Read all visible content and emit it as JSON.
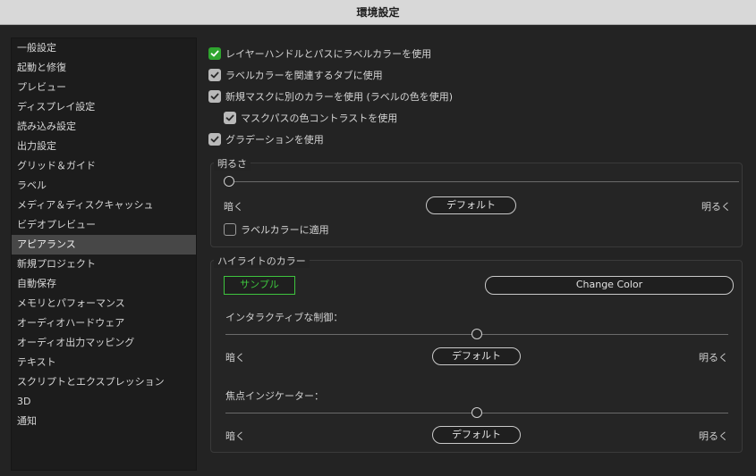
{
  "window": {
    "title": "環境設定"
  },
  "sidebar": {
    "items": [
      {
        "label": "一般設定"
      },
      {
        "label": "起動と修復"
      },
      {
        "label": "プレビュー"
      },
      {
        "label": "ディスプレイ設定"
      },
      {
        "label": "読み込み設定"
      },
      {
        "label": "出力設定"
      },
      {
        "label": "グリッド＆ガイド"
      },
      {
        "label": "ラベル"
      },
      {
        "label": "メディア＆ディスクキャッシュ"
      },
      {
        "label": "ビデオプレビュー"
      },
      {
        "label": "アピアランス",
        "selected": true
      },
      {
        "label": "新規プロジェクト"
      },
      {
        "label": "自動保存"
      },
      {
        "label": "メモリとパフォーマンス"
      },
      {
        "label": "オーディオハードウェア"
      },
      {
        "label": "オーディオ出力マッピング"
      },
      {
        "label": "テキスト"
      },
      {
        "label": "スクリプトとエクスプレッション"
      },
      {
        "label": "3D"
      },
      {
        "label": "通知"
      }
    ]
  },
  "options": {
    "layer_handles": {
      "label": "レイヤーハンドルとパスにラベルカラーを使用",
      "checked": true
    },
    "related_tabs": {
      "label": "ラベルカラーを関連するタブに使用",
      "checked": true
    },
    "new_mask": {
      "label": "新規マスクに別のカラーを使用 (ラベルの色を使用)",
      "checked": true
    },
    "mask_path_contrast": {
      "label": "マスクパスの色コントラストを使用",
      "checked": true
    },
    "gradients": {
      "label": "グラデーションを使用",
      "checked": true
    }
  },
  "brightness": {
    "title": "明るさ",
    "value": 0.0,
    "dark_label": "暗く",
    "light_label": "明るく",
    "default_label": "デフォルト",
    "apply_label": {
      "label": "ラベルカラーに適用",
      "checked": false
    }
  },
  "highlight": {
    "title": "ハイライトのカラー",
    "sample_label": "サンプル",
    "sample_color": "#3ec43e",
    "change_color_label": "Change Color",
    "interactive": {
      "title": "インタラクティブな制御：",
      "value": 0.5,
      "dark_label": "暗く",
      "light_label": "明るく",
      "default_label": "デフォルト"
    },
    "focus": {
      "title": "焦点インジケーター：",
      "value": 0.5,
      "dark_label": "暗く",
      "light_label": "明るく",
      "default_label": "デフォルト"
    }
  },
  "colors": {
    "checkbox_accent": "#2fa52f",
    "checkbox_muted": "#b9b9b9",
    "selected_item": "#474747"
  }
}
